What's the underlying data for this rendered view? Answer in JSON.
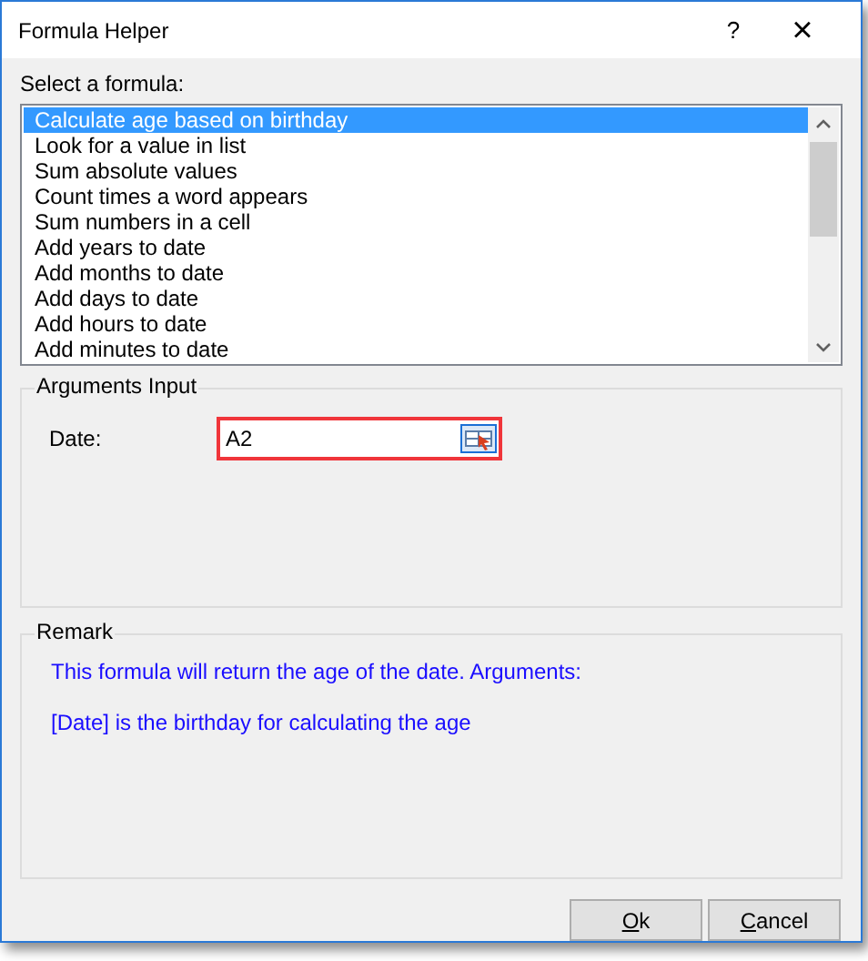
{
  "window": {
    "title": "Formula Helper",
    "help": "?",
    "close": "×"
  },
  "formula_list": {
    "label": "Select a formula:",
    "items": [
      {
        "label": "Calculate age based on birthday",
        "selected": true
      },
      {
        "label": "Look for a value in list",
        "selected": false
      },
      {
        "label": "Sum absolute values",
        "selected": false
      },
      {
        "label": "Count times a word appears",
        "selected": false
      },
      {
        "label": "Sum numbers in a cell",
        "selected": false
      },
      {
        "label": "Add years to date",
        "selected": false
      },
      {
        "label": "Add months to date",
        "selected": false
      },
      {
        "label": "Add days to date",
        "selected": false
      },
      {
        "label": "Add hours to date",
        "selected": false
      },
      {
        "label": "Add minutes to date",
        "selected": false
      }
    ]
  },
  "arguments": {
    "title": "Arguments Input",
    "fields": [
      {
        "label": "Date:",
        "value": "A2",
        "highlighted": true
      }
    ]
  },
  "remark": {
    "title": "Remark",
    "lines": [
      "This formula will return the age of the date. Arguments:",
      "[Date] is the birthday for calculating the age"
    ]
  },
  "buttons": [
    {
      "accel": "O",
      "rest": "k"
    },
    {
      "accel": "C",
      "rest": "ancel"
    }
  ]
}
